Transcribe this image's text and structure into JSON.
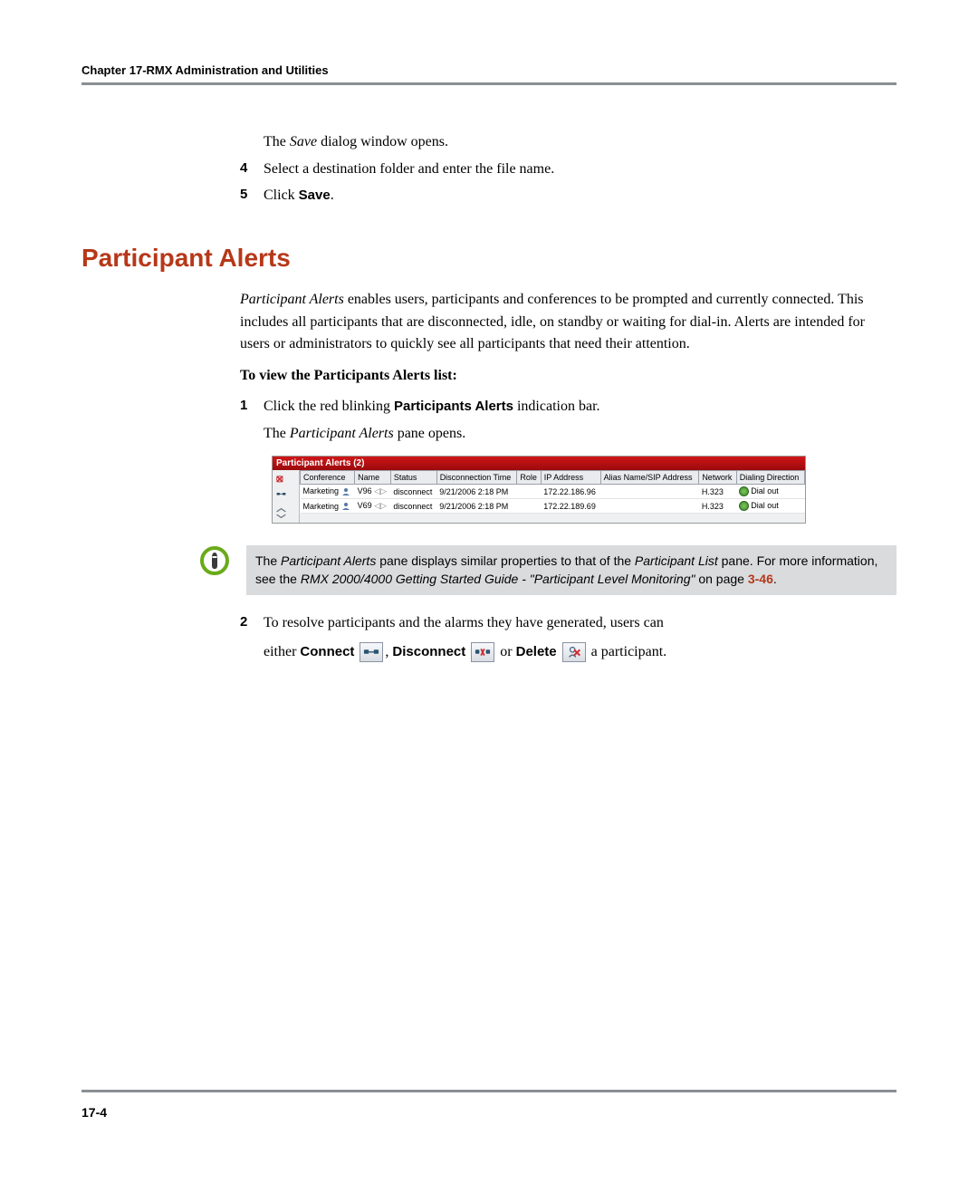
{
  "header": "Chapter 17-RMX Administration and Utilities",
  "intro_line": {
    "pre": "The ",
    "em": "Save",
    "post": " dialog window opens."
  },
  "step4": {
    "num": "4",
    "text": "Select a destination folder and enter the file name."
  },
  "step5": {
    "num": "5",
    "pre": "Click ",
    "bold": "Save",
    "post": "."
  },
  "section_title": "Participant Alerts",
  "section_para": "Participant Alerts enables users, participants and conferences to be prompted and currently connected. This includes all participants that are disconnected, idle, on standby or waiting for dial-in. Alerts are intended for users or administrators to quickly see all participants that need their attention.",
  "section_para_lead": "Participant Alerts",
  "to_view_label": "To view the Participants Alerts list:",
  "step1": {
    "num": "1",
    "pre": "Click the red blinking ",
    "bold": "Participants Alerts",
    "post": " indication bar."
  },
  "step1b": {
    "pre": "The ",
    "em": "Participant Alerts",
    "post": " pane opens."
  },
  "screenshot": {
    "title": "Participant Alerts (2)",
    "columns": [
      "Conference",
      "Name",
      "Status",
      "Disconnection Time",
      "Role",
      "IP Address",
      "Alias Name/SIP Address",
      "Network",
      "Dialing Direction"
    ],
    "rows": [
      {
        "conference": "Marketing",
        "name": "V96",
        "status": "disconnect",
        "time": "9/21/2006 2:18 PM",
        "role": "",
        "ip": "172.22.186.96",
        "alias": "",
        "network": "H.323",
        "dial": "Dial out"
      },
      {
        "conference": "Marketing",
        "name": "V69",
        "status": "disconnect",
        "time": "9/21/2006 2:18 PM",
        "role": "",
        "ip": "172.22.189.69",
        "alias": "",
        "network": "H.323",
        "dial": "Dial out"
      }
    ]
  },
  "note": {
    "p1a": "The ",
    "p1em1": "Participant Alerts",
    "p1b": " pane displays similar properties to that of the ",
    "p1em2": "Participant List",
    "p1c": " pane. For more information, see the ",
    "p1em3": "RMX 2000/4000 Getting Started Guide - \"Participant Level Monitoring\"",
    "p1d": " on page ",
    "ref": "3-46",
    "p1e": "."
  },
  "step2": {
    "num": "2",
    "line1": "To resolve participants and the alarms they have generated, users can",
    "line2_a": "either ",
    "connect": "Connect",
    "line2_b": ", ",
    "disconnect": "Disconnect",
    "line2_c": " or ",
    "delete": "Delete",
    "line2_d": " a participant."
  },
  "page_number": "17-4"
}
